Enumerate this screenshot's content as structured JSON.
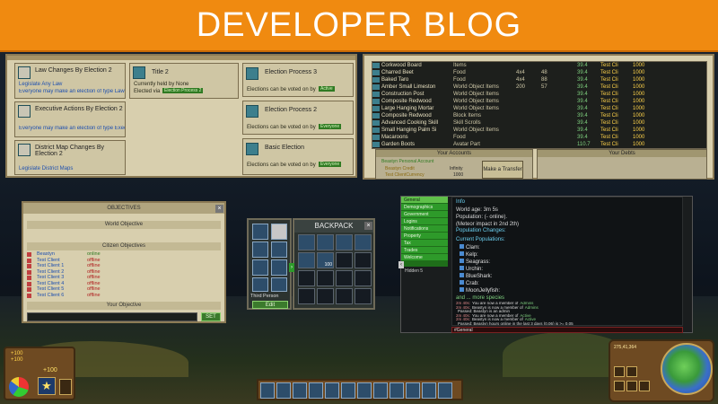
{
  "banner": {
    "title": "DEVELOPER BLOG"
  },
  "laws": {
    "items": [
      {
        "title": "Law Changes By Election 2",
        "sub1": "Legislate Any Law",
        "sub2": "Everyone may make an election of type Law Process"
      },
      {
        "title": "Executive Actions By Election 2",
        "sub1": "Everyone may make an election of type Executive Actions",
        "sub2": ""
      },
      {
        "title": "District Map Changes By Election 2",
        "sub1": "Legislate District Maps",
        "sub2": ""
      }
    ],
    "mid": {
      "title": "Title 2",
      "line1": "Currently held by None",
      "line2": "Elected via",
      "chip": "Election Process 2"
    },
    "right": [
      {
        "title": "Election Process 3",
        "sub": "Elections can be voted on by",
        "chip": "Active"
      },
      {
        "title": "Election Process 2",
        "sub": "Elections can be voted on by",
        "chip": "Everyone"
      },
      {
        "title": "Basic Election",
        "sub": "Elections can be voted on by",
        "chip": "Everyone"
      }
    ]
  },
  "market": {
    "rows": [
      {
        "name": "Corkwood Board",
        "type": "Items",
        "q": "",
        "p": "",
        "a": "",
        "price": "39.4",
        "store": "Test Cli",
        "lim": "1000"
      },
      {
        "name": "Charred Beet",
        "type": "Food",
        "q": "4x4",
        "p": "48",
        "a": "",
        "price": "39.4",
        "store": "Test Cli",
        "lim": "1000"
      },
      {
        "name": "Baked Taro",
        "type": "Food",
        "q": "4x4",
        "p": "88",
        "a": "",
        "price": "39.4",
        "store": "Test Cli",
        "lim": "1000"
      },
      {
        "name": "Amber Small Limeston",
        "type": "World Object Items",
        "q": "200",
        "p": "57",
        "a": "",
        "price": "39.4",
        "store": "Test Cli",
        "lim": "1000"
      },
      {
        "name": "Construction Post",
        "type": "World Object Items",
        "q": "",
        "p": "",
        "a": "",
        "price": "39.4",
        "store": "Test Cli",
        "lim": "1000"
      },
      {
        "name": "Composite Redwood",
        "type": "World Object Items",
        "q": "",
        "p": "",
        "a": "",
        "price": "39.4",
        "store": "Test Cli",
        "lim": "1000"
      },
      {
        "name": "Large Hanging Mortar",
        "type": "World Object Items",
        "q": "",
        "p": "",
        "a": "",
        "price": "39.4",
        "store": "Test Cli",
        "lim": "1000"
      },
      {
        "name": "Composite Redwood",
        "type": "Block Items",
        "q": "",
        "p": "",
        "a": "",
        "price": "39.4",
        "store": "Test Cli",
        "lim": "1000"
      },
      {
        "name": "Advanced Cooking Skill",
        "type": "Skill Scrolls",
        "q": "",
        "p": "",
        "a": "",
        "price": "39.4",
        "store": "Test Cli",
        "lim": "1000"
      },
      {
        "name": "Small Hanging Palm Si",
        "type": "World Object Items",
        "q": "",
        "p": "",
        "a": "",
        "price": "39.4",
        "store": "Test Cli",
        "lim": "1000"
      },
      {
        "name": "Macaroons",
        "type": "Food",
        "q": "",
        "p": "",
        "a": "",
        "price": "39.4",
        "store": "Test Cli",
        "lim": "1000"
      },
      {
        "name": "Garden Boots",
        "type": "Avatar Part",
        "q": "",
        "p": "",
        "a": "",
        "price": "110.7",
        "store": "Test Cli",
        "lim": "1000"
      }
    ],
    "accounts_title": "Your Accounts",
    "account_name": "Beastyn Personal Account",
    "account_line2": "Beastyn Credit",
    "account_line3": "Test ClientCurrency",
    "account_val1": "Infinity",
    "account_val2": "1000",
    "transfer_label": "Make a Transfer",
    "debts_title": "Your Debts"
  },
  "objectives": {
    "title": "OBJECTIVES",
    "world": "World Objective",
    "citizen": "Citizen Objectives",
    "citizens": [
      {
        "name": "Beastyn",
        "status": "online"
      },
      {
        "name": "Test Client",
        "status": "offline"
      },
      {
        "name": "Test Client 1",
        "status": "offline"
      },
      {
        "name": "Test Client 2",
        "status": "offline"
      },
      {
        "name": "Test Client 3",
        "status": "offline"
      },
      {
        "name": "Test Client 4",
        "status": "offline"
      },
      {
        "name": "Test Client 5",
        "status": "offline"
      },
      {
        "name": "Test Client 6",
        "status": "offline"
      }
    ],
    "your": "Your Objective",
    "set_label": "SET"
  },
  "avatar": {
    "third_person": "Third Person",
    "edit_label": "Edit"
  },
  "backpack": {
    "title": "BACKPACK",
    "close": "x",
    "stack": "100"
  },
  "world_panel": {
    "nav": [
      "General",
      "Demographics",
      "Government",
      "Logins",
      "Notifications",
      "Property",
      "Tax",
      "Trades",
      "Welcome"
    ],
    "hidden": "Hidden 5",
    "lines": [
      "Info",
      "World age: 3m 5s",
      "Population: (- online).",
      "(Meteor impact in 2nd 2th)",
      "Population Changes:"
    ],
    "current_pop": "Current Populations:",
    "species": [
      "Clam:",
      "Kelp:",
      "Seagrass:",
      "Urchin:",
      "BlueShark:",
      "Crab:",
      "MoonJellyfish:"
    ],
    "more": "and ... more species",
    "log": [
      {
        "time": "2m 40s:",
        "text": "You are now a member of",
        "chip": "Admins"
      },
      {
        "time": "2m 40s:",
        "text": "Beastyn is now a member of",
        "chip": "Admins"
      },
      {
        "time": "",
        "text": "Passed: Beastyn is an admin",
        "chip": ""
      },
      {
        "time": "2m 40s:",
        "text": "You are now a member of",
        "chip": "Active"
      },
      {
        "time": "2m 40s:",
        "text": "Beastyn is now a member of",
        "chip": "Active"
      },
      {
        "time": "",
        "text": "Passed: Beastyn hours online in the last 3 days (0.06) is >= 0.05",
        "chip": ""
      }
    ],
    "tab": "#General"
  },
  "hud": {
    "coins": "+100",
    "stat1": "+100",
    "stat2": "+100",
    "coords": "275,41,364",
    "hotbar_count": 12
  },
  "colors": {
    "banner": "#f08a10",
    "green": "#2e9a2a",
    "parchment": "#d8cfae"
  }
}
